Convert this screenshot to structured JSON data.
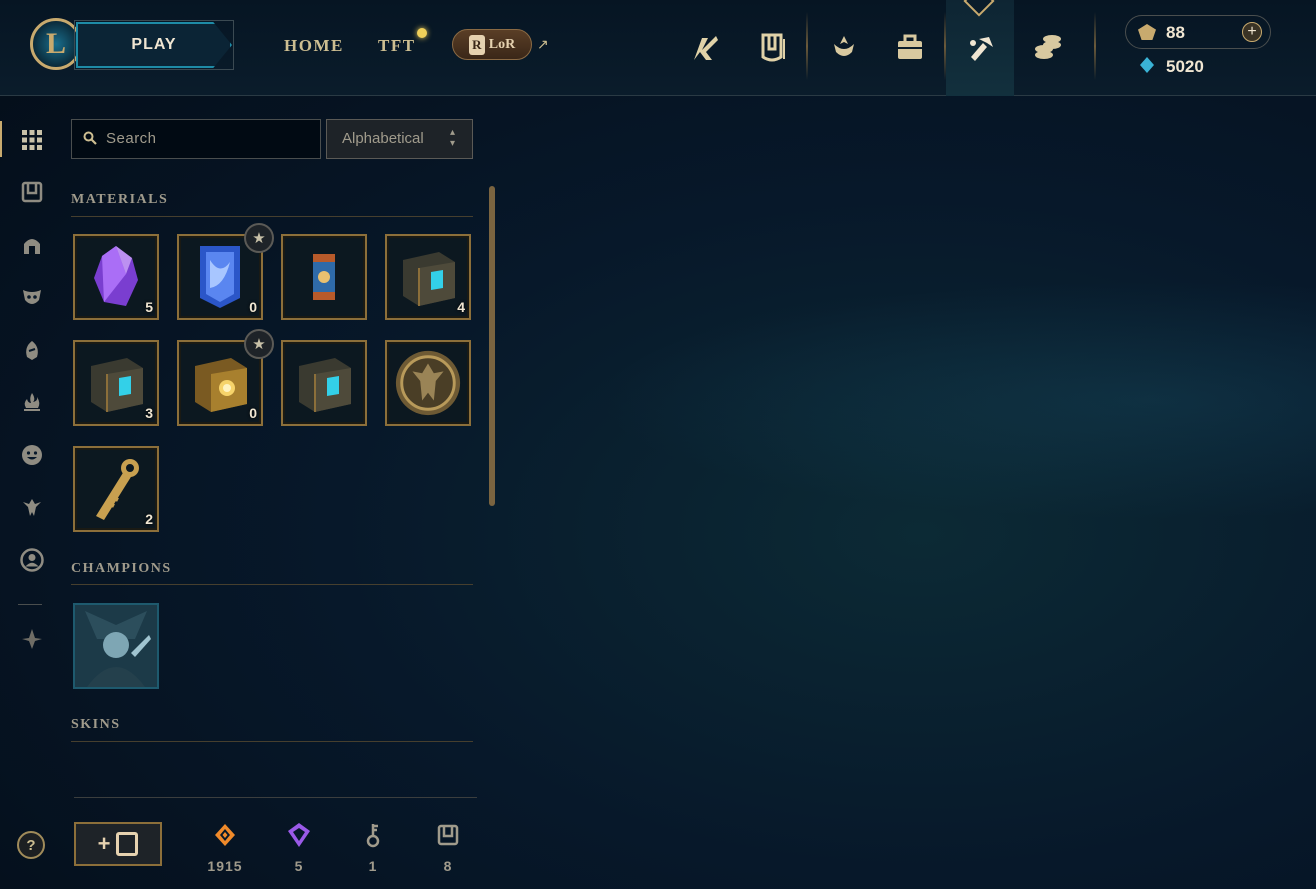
{
  "topbar": {
    "play_label": "PLAY",
    "nav": [
      {
        "label": "HOME"
      },
      {
        "label": "TFT"
      }
    ],
    "lor": {
      "label": "LoR",
      "badge": "R"
    },
    "currencies": {
      "rp": "88",
      "blue_essence": "5020"
    }
  },
  "search": {
    "placeholder": "Search"
  },
  "sort": {
    "selected": "Alphabetical"
  },
  "sections": {
    "materials": "MATERIALS",
    "champions": "CHAMPIONS",
    "skins": "SKINS"
  },
  "materials": [
    {
      "name": "purple-crystal",
      "count": "5"
    },
    {
      "name": "blue-banner-capsule",
      "count": "0",
      "starred": true
    },
    {
      "name": "lantern-capsule",
      "count": ""
    },
    {
      "name": "hextech-chest",
      "count": "4"
    },
    {
      "name": "hextech-chest-2",
      "count": "3"
    },
    {
      "name": "masterwork-chest",
      "count": "0",
      "starred": true
    },
    {
      "name": "hextech-chest-3",
      "count": ""
    },
    {
      "name": "gold-emblem-token",
      "count": ""
    },
    {
      "name": "hextech-key",
      "count": "2"
    }
  ],
  "footer": {
    "orange_essence": "1915",
    "mythic_essence": "5",
    "keys": "1",
    "chests": "8"
  },
  "colors": {
    "gold": "#c8aa6e",
    "accent_blue": "#1e8ba6",
    "text": "#cdbe91",
    "bg": "#07182a"
  }
}
